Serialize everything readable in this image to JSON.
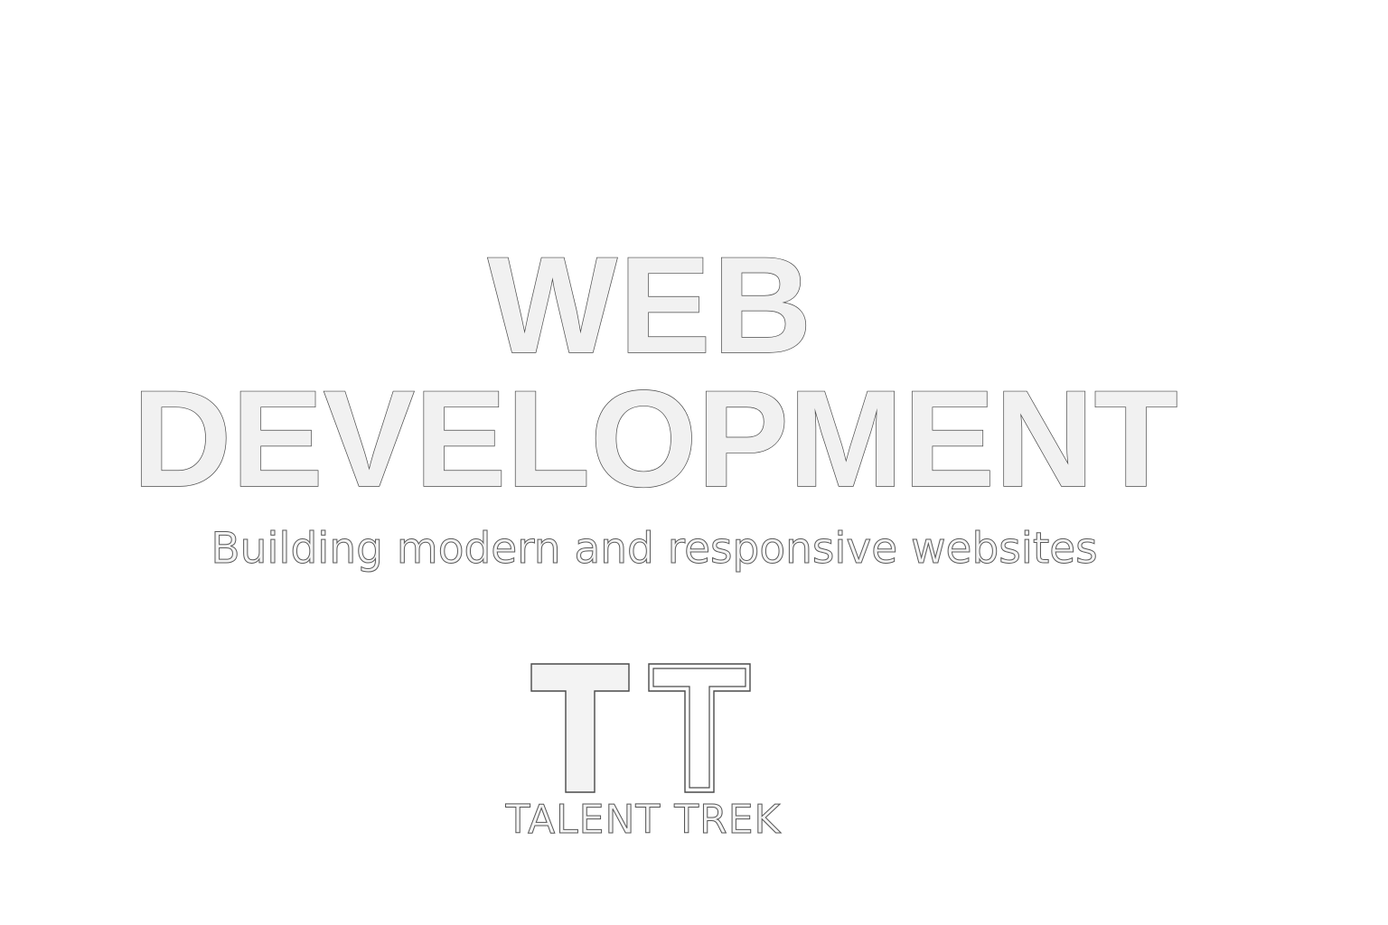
{
  "headline": {
    "line1": "WEB",
    "line2": "DEVELOPMENT"
  },
  "tagline": "Building modern and responsive websites",
  "brand": {
    "monogram": "TT",
    "name": "TALENT TREK"
  },
  "colors": {
    "background": "#ffffff",
    "letter_fill": "#f1f1f1",
    "letter_outline": "#4a4a4a"
  }
}
